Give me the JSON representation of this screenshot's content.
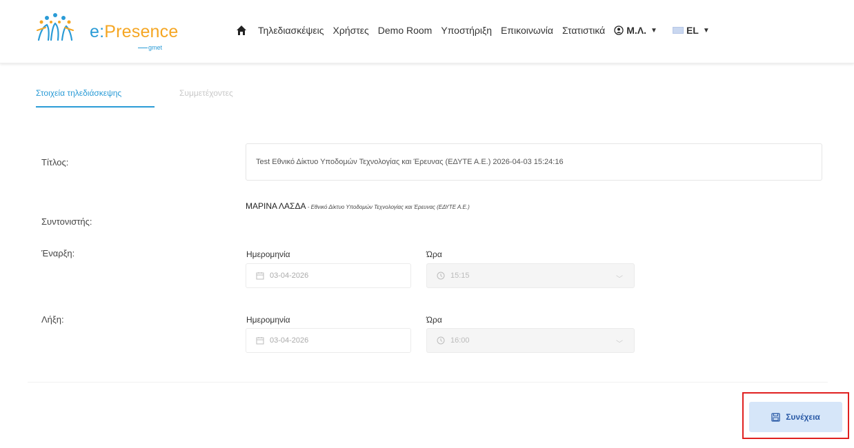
{
  "brand": {
    "name_prefix": "e:",
    "name": "Presence",
    "sub": "gmet",
    "accent": "#2a9bd6",
    "orange": "#f5a623"
  },
  "nav": {
    "home_icon": "home-icon",
    "items": [
      "Τηλεδιασκέψεις",
      "Χρήστες",
      "Demo Room",
      "Υποστήριξη",
      "Επικοινωνία",
      "Στατιστικά"
    ],
    "user": "M.Λ.",
    "lang": "EL"
  },
  "tabs": {
    "active": "Στοιχεία τηλεδιάσκεψης",
    "inactive": "Συμμετέχοντες"
  },
  "form": {
    "title_label": "Τίτλος:",
    "title_value": "Test Εθνικό Δίκτυο Υποδομών Τεχνολογίας και Έρευνας (ΕΔΥΤΕ Α.Ε.) 2026-04-03 15:24:16",
    "moderator_label": "Συντονιστής:",
    "moderator_name": "ΜΑΡΙΝΑ ΛΑΣΔΑ",
    "moderator_org": " - Εθνικό Δίκτυο Υποδομών Τεχνολογίας και Έρευνας (ΕΔΥΤΕ Α.Ε.)",
    "start_label": "Έναρξη:",
    "end_label": "Λήξη:",
    "date_label": "Ημερομηνία",
    "time_label": "Ώρα",
    "start_date": "03-04-2026",
    "start_time": "15:15",
    "end_date": "03-04-2026",
    "end_time": "16:00"
  },
  "actions": {
    "continue_label": "Συνέχεια",
    "highlight_color": "#e0201f"
  }
}
